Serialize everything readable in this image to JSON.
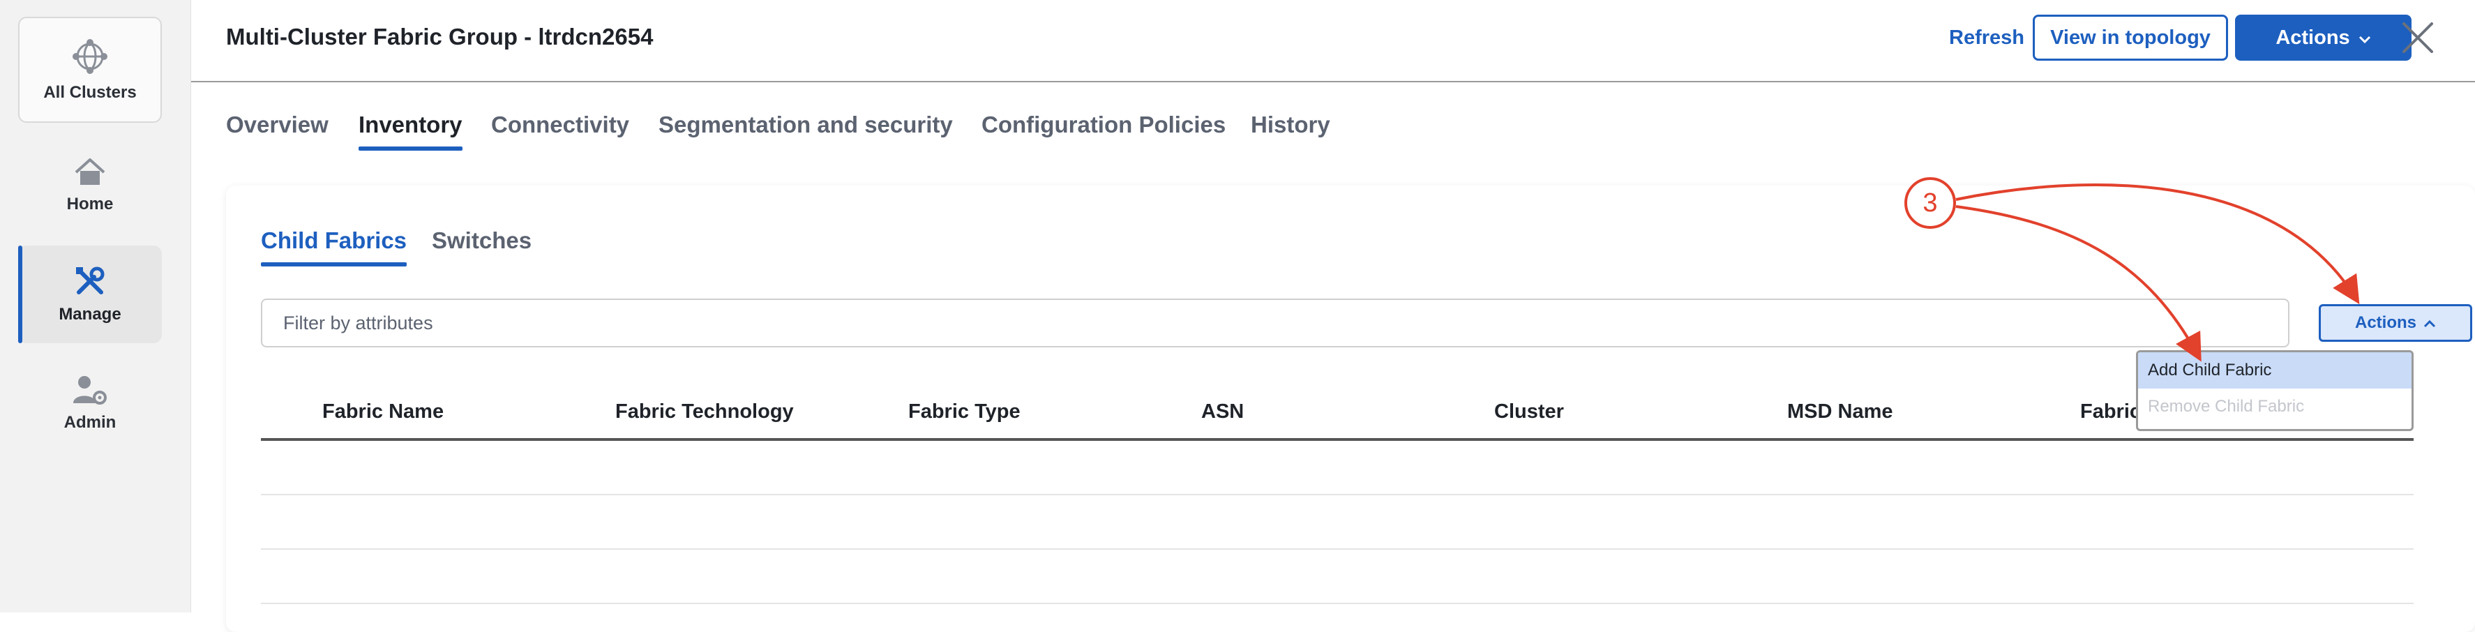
{
  "rail": {
    "items": [
      {
        "label": "All Clusters",
        "icon": "globe-icon"
      },
      {
        "label": "Home",
        "icon": "home-icon"
      },
      {
        "label": "Manage",
        "icon": "tools-icon"
      },
      {
        "label": "Admin",
        "icon": "user-gear-icon"
      }
    ]
  },
  "header": {
    "title": "Multi-Cluster Fabric Group - ltrdcn2654",
    "refresh_label": "Refresh",
    "topology_label": "View in topology",
    "actions_label": "Actions"
  },
  "tabs": [
    "Overview",
    "Inventory",
    "Connectivity",
    "Segmentation and security",
    "Configuration Policies",
    "History"
  ],
  "subtabs": [
    "Child Fabrics",
    "Switches"
  ],
  "filter": {
    "placeholder": "Filter by attributes"
  },
  "table": {
    "actions_label": "Actions",
    "columns": [
      "Fabric Name",
      "Fabric Technology",
      "Fabric Type",
      "ASN",
      "Cluster",
      "MSD Name",
      "Fabric"
    ]
  },
  "dropdown": {
    "items": [
      {
        "label": "Add Child Fabric",
        "state": "highlighted"
      },
      {
        "label": "Remove Child Fabric",
        "state": "disabled"
      }
    ]
  },
  "annotation": {
    "step": "3"
  },
  "colors": {
    "accent": "#1d5fbf",
    "annotation": "#e2412c"
  }
}
